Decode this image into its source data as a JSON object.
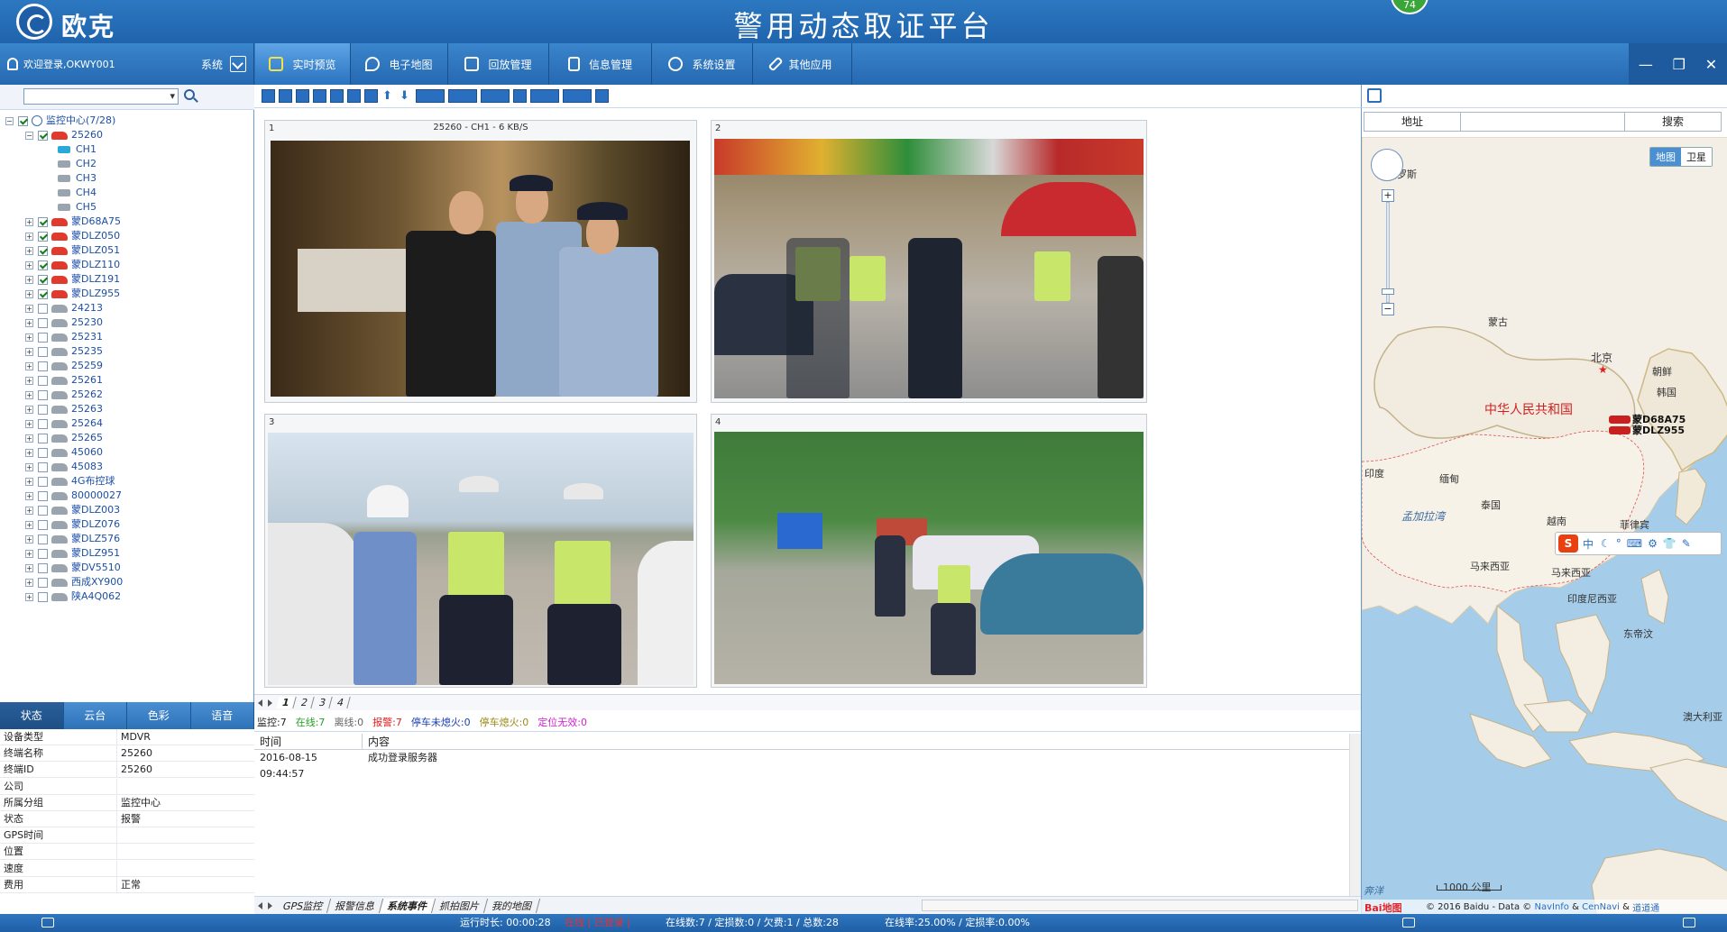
{
  "header": {
    "brand": "欧克",
    "title": "警用动态取证平台",
    "badge": "74"
  },
  "user": {
    "welcome": "欢迎登录,OKWY001",
    "system_label": "系统"
  },
  "nav": {
    "tabs": [
      {
        "label": "实时预览",
        "icon": "video-preview-icon",
        "active": true
      },
      {
        "label": "电子地图",
        "icon": "map-pin-icon"
      },
      {
        "label": "回放管理",
        "icon": "playback-icon"
      },
      {
        "label": "信息管理",
        "icon": "document-icon"
      },
      {
        "label": "系统设置",
        "icon": "gear-icon"
      },
      {
        "label": "其他应用",
        "icon": "wrench-icon"
      }
    ]
  },
  "window_controls": {
    "minimize": "—",
    "restore": "❐",
    "close": "✕"
  },
  "tree": {
    "root": "监控中心(7/28)",
    "device": "25260",
    "channels": [
      "CH1",
      "CH2",
      "CH3",
      "CH4",
      "CH5"
    ],
    "vehicles": [
      {
        "name": "蒙D68A75",
        "online": true
      },
      {
        "name": "蒙DLZ050",
        "online": true
      },
      {
        "name": "蒙DLZ051",
        "online": true
      },
      {
        "name": "蒙DLZ110",
        "online": true
      },
      {
        "name": "蒙DLZ191",
        "online": true
      },
      {
        "name": "蒙DLZ955",
        "online": true
      },
      {
        "name": "24213",
        "online": false
      },
      {
        "name": "25230",
        "online": false
      },
      {
        "name": "25231",
        "online": false
      },
      {
        "name": "25235",
        "online": false
      },
      {
        "name": "25259",
        "online": false
      },
      {
        "name": "25261",
        "online": false
      },
      {
        "name": "25262",
        "online": false
      },
      {
        "name": "25263",
        "online": false
      },
      {
        "name": "25264",
        "online": false
      },
      {
        "name": "25265",
        "online": false
      },
      {
        "name": "45060",
        "online": false
      },
      {
        "name": "45083",
        "online": false
      },
      {
        "name": "4G布控球",
        "online": false
      },
      {
        "name": "80000027",
        "online": false
      },
      {
        "name": "蒙DLZ003",
        "online": false
      },
      {
        "name": "蒙DLZ076",
        "online": false
      },
      {
        "name": "蒙DLZ576",
        "online": false
      },
      {
        "name": "蒙DLZ951",
        "online": false
      },
      {
        "name": "蒙DV5510",
        "online": false
      },
      {
        "name": "西成XY900",
        "online": false
      },
      {
        "name": "陕A4Q062",
        "online": false
      }
    ]
  },
  "status_tabs": [
    "状态",
    "云台",
    "色彩",
    "语音"
  ],
  "device_info": [
    {
      "k": "设备类型",
      "v": "MDVR"
    },
    {
      "k": "终端名称",
      "v": "25260"
    },
    {
      "k": "终端ID",
      "v": "25260"
    },
    {
      "k": "公司",
      "v": ""
    },
    {
      "k": "所属分组",
      "v": "监控中心"
    },
    {
      "k": "状态",
      "v": "报警"
    },
    {
      "k": "GPS时间",
      "v": ""
    },
    {
      "k": "位置",
      "v": ""
    },
    {
      "k": "速度",
      "v": ""
    },
    {
      "k": "费用",
      "v": "正常"
    }
  ],
  "video": {
    "panes": [
      {
        "num": "1",
        "caption": "25260 - CH1 - 6 KB/S"
      },
      {
        "num": "2",
        "caption": ""
      },
      {
        "num": "3",
        "caption": ""
      },
      {
        "num": "4",
        "caption": ""
      }
    ],
    "pages": [
      "1",
      "2",
      "3",
      "4"
    ]
  },
  "stats": {
    "monitor": "监控:7",
    "online": "在线:7",
    "offline": "离线:0",
    "alarm": "报警:7",
    "stopped_running": "停车未熄火:0",
    "stopped_off": "停车熄火:0",
    "invalid": "定位无效:0"
  },
  "log": {
    "headers": [
      "时间",
      "内容"
    ],
    "rows": [
      {
        "time": "2016-08-15 09:44:57",
        "content": "成功登录服务器"
      }
    ]
  },
  "bottom_tabs": [
    "GPS监控",
    "报警信息",
    "系统事件",
    "抓拍图片",
    "我的地图"
  ],
  "map": {
    "addr_label": "地址",
    "search_label": "搜索",
    "type_map": "地图",
    "type_sat": "卫星",
    "labels": {
      "russia": "俄罗斯",
      "mongolia": "蒙古",
      "beijing": "北京",
      "korea_n": "朝鲜",
      "korea_s": "韩国",
      "china": "中华人民共和国",
      "india": "印度",
      "myanmar": "缅甸",
      "thailand": "泰国",
      "vietnam": "越南",
      "philippines": "菲律宾",
      "bay": "孟加拉湾",
      "malay1": "马来西亚",
      "malay2": "马来西亚",
      "indonesia": "印度尼西亚",
      "timor": "东帝汶",
      "australia": "澳大利亚",
      "sea": "奔洋"
    },
    "markers": [
      "蒙D68A75",
      "蒙DLZ955"
    ],
    "ime_label": "中",
    "scale": "1000 公里",
    "copyright_prefix": "© 2016 Baidu - Data ©",
    "navinfo": "NavInfo",
    "amp1": "&",
    "cennavi": "CenNavi",
    "amp2": "&",
    "daodaotong": "道道通",
    "baidu_logo": "Bai地图"
  },
  "statusbar": {
    "runtime": "运行时长: 00:00:28",
    "status": "在线 | 已登录 | ",
    "counts": "在线数:7 / 定损数:0 / 欠费:1 / 总数:28",
    "rates": "在线率:25.00% / 定损率:0.00%"
  },
  "colors": {
    "header": "#1f64ad",
    "online_green": "#22a022",
    "alarm_red": "#e02020",
    "stopped_run": "#1a3fb0",
    "stopped_off": "#9a8a1a",
    "invalid": "#d020d0"
  }
}
